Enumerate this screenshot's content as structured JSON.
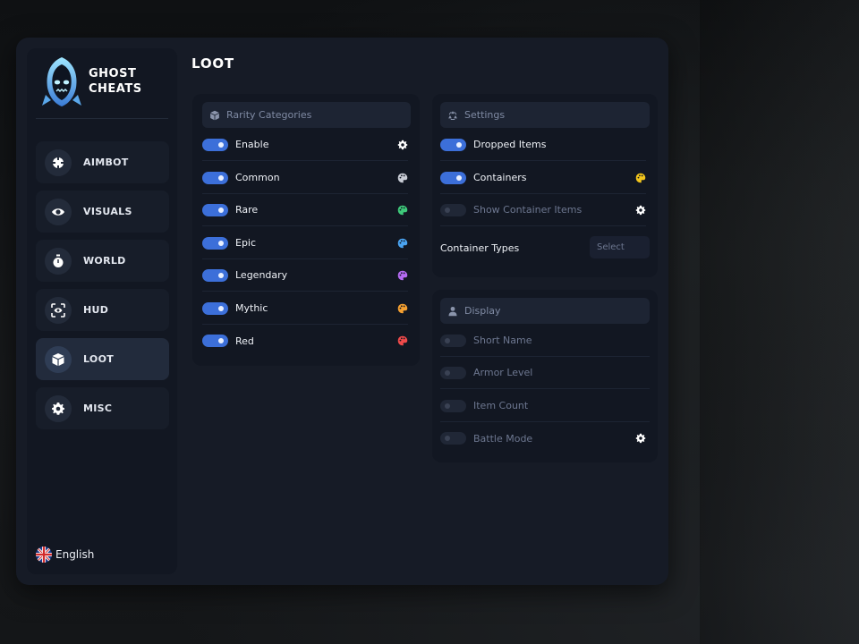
{
  "brand": {
    "line1": "GHOST",
    "line2": "CHEATS"
  },
  "nav": [
    {
      "label": "AIMBOT",
      "icon": "crosshair-icon",
      "active": false
    },
    {
      "label": "VISUALS",
      "icon": "eye-icon",
      "active": false
    },
    {
      "label": "WORLD",
      "icon": "stopwatch-icon",
      "active": false
    },
    {
      "label": "HUD",
      "icon": "hud-scan-icon",
      "active": false
    },
    {
      "label": "LOOT",
      "icon": "box-icon",
      "active": true
    },
    {
      "label": "MISC",
      "icon": "gear-icon",
      "active": false
    }
  ],
  "language": {
    "label": "English",
    "icon": "uk-flag-icon"
  },
  "page": {
    "title": "LOOT"
  },
  "rarity": {
    "header": "Rarity Categories",
    "header_icon": "box-icon",
    "items": [
      {
        "label": "Enable",
        "on": true,
        "icon": "gear-icon",
        "color": "#ffffff"
      },
      {
        "label": "Common",
        "on": true,
        "icon": "palette-icon",
        "color": "#c9cdd6"
      },
      {
        "label": "Rare",
        "on": true,
        "icon": "palette-icon",
        "color": "#3ec97a"
      },
      {
        "label": "Epic",
        "on": true,
        "icon": "palette-icon",
        "color": "#4aa3f0"
      },
      {
        "label": "Legendary",
        "on": true,
        "icon": "palette-icon",
        "color": "#b46af2"
      },
      {
        "label": "Mythic",
        "on": true,
        "icon": "palette-icon",
        "color": "#f5a030"
      },
      {
        "label": "Red",
        "on": true,
        "icon": "palette-icon",
        "color": "#ef4a4a"
      }
    ]
  },
  "settings": {
    "header": "Settings",
    "header_icon": "recycle-icon",
    "items": [
      {
        "label": "Dropped Items",
        "on": true,
        "icon": "",
        "color": ""
      },
      {
        "label": "Containers",
        "on": true,
        "icon": "palette-icon",
        "color": "#f2c51c"
      },
      {
        "label": "Show Container Items",
        "on": false,
        "icon": "gear-icon",
        "color": "#ffffff"
      }
    ],
    "container_types": {
      "label": "Container Types",
      "select": "Select"
    }
  },
  "display": {
    "header": "Display",
    "header_icon": "user-icon",
    "items": [
      {
        "label": "Short Name",
        "on": false,
        "icon": "",
        "color": ""
      },
      {
        "label": "Armor Level",
        "on": false,
        "icon": "",
        "color": ""
      },
      {
        "label": "Item Count",
        "on": false,
        "icon": "",
        "color": ""
      },
      {
        "label": "Battle Mode",
        "on": false,
        "icon": "gear-icon",
        "color": "#ffffff"
      }
    ]
  },
  "colors": {
    "accent": "#3c6fd9",
    "window_bg": "#161b26",
    "card_bg": "#121722"
  }
}
